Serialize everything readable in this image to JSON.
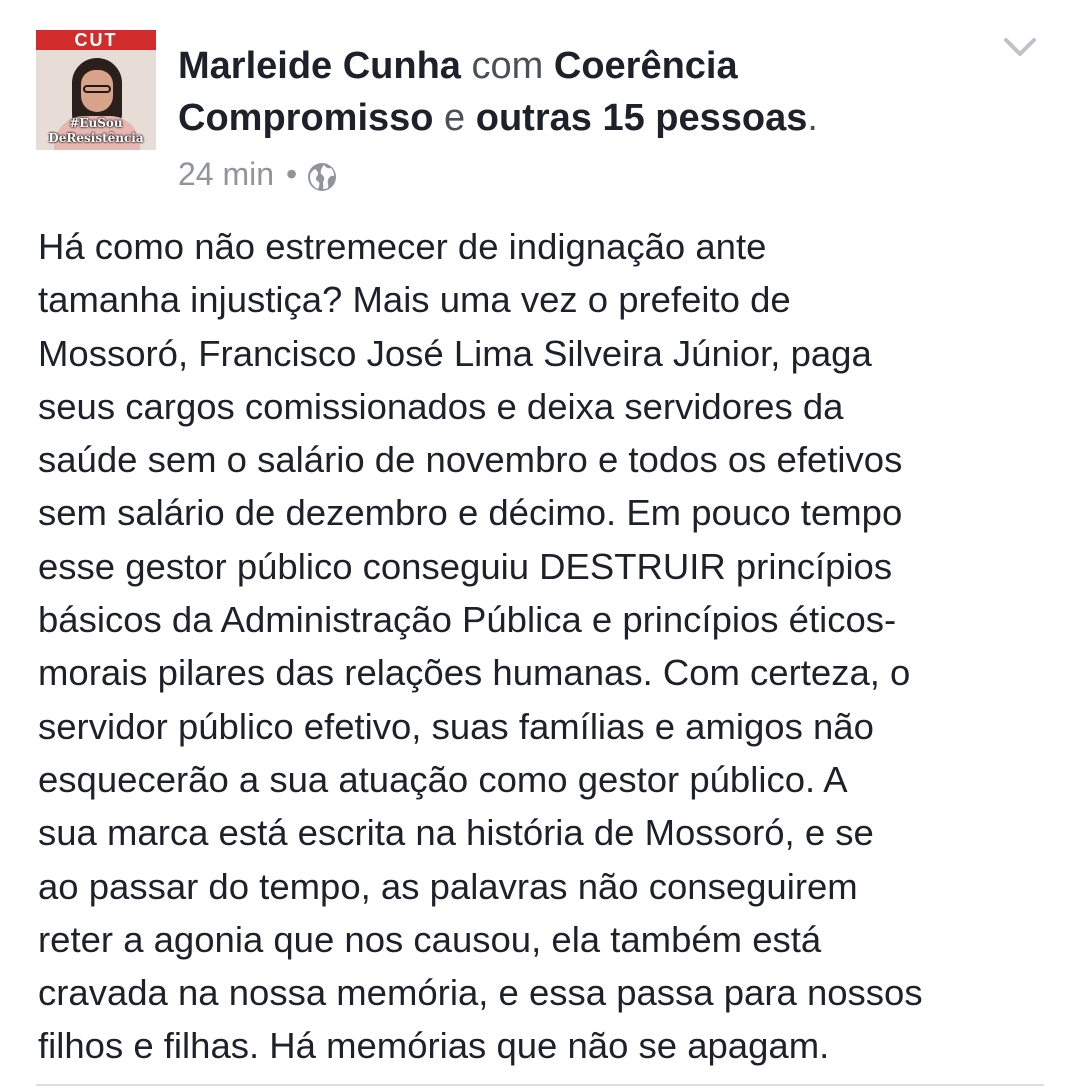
{
  "post": {
    "avatar": {
      "banner_text": "CUT",
      "tag_line1": "#EuSou",
      "tag_line2": "DeResistência"
    },
    "author": "Marleide Cunha",
    "with_word": "com",
    "tagged_page": "Coerência Compromisso",
    "and_word": "e",
    "others": "outras 15 pessoas",
    "period": ".",
    "time": "24 min",
    "separator": "•",
    "privacy_icon": "globe-icon",
    "menu_icon": "chevron-down-icon",
    "body": "Há como não estremecer de indignação ante\ntamanha injustiça? Mais uma vez o prefeito de\nMossoró, Francisco José Lima Silveira Júnior, paga\nseus cargos comissionados e deixa servidores da\nsaúde sem o salário de novembro e todos os efetivos\nsem salário de dezembro e décimo. Em pouco tempo\nesse gestor público conseguiu DESTRUIR princípios\nbásicos da Administração Pública e princípios éticos-\nmorais pilares das relações humanas. Com certeza, o\nservidor público efetivo, suas famílias e amigos não\nesquecerão a sua atuação como gestor público. A\nsua marca está escrita na história de Mossoró, e se\nao passar do tempo, as palavras  não conseguirem\nreter a agonia que nos causou, ela também está\ncravada na nossa memória, e essa passa para nossos\nfilhos e filhas. Há memórias que não se apagam."
  },
  "colors": {
    "text": "#1d2129",
    "muted": "#90949c",
    "secondary": "#4b4f56",
    "divider": "#dddfe2"
  }
}
